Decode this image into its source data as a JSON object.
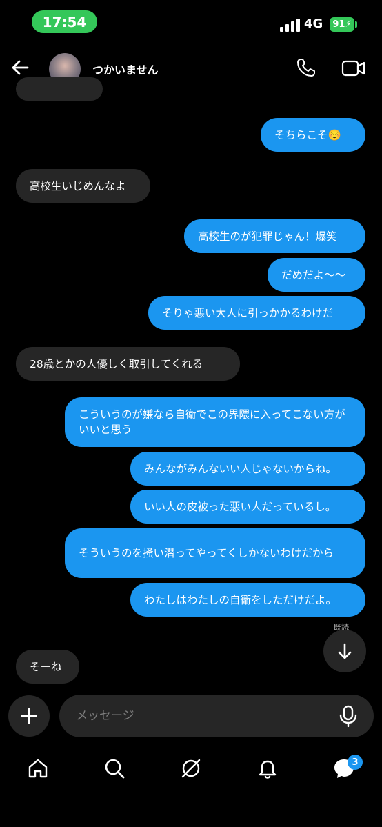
{
  "status_bar": {
    "time": "17:54",
    "network": "4G",
    "battery": "91"
  },
  "header": {
    "contact_name": "つかいません"
  },
  "messages": [
    {
      "side": "out",
      "text": "そちらこそ☺️"
    },
    {
      "side": "in",
      "text": "高校生いじめんなよ"
    },
    {
      "side": "out",
      "text": "高校生のが犯罪じゃん！爆笑"
    },
    {
      "side": "out",
      "text": "だめだよ〜〜"
    },
    {
      "side": "out",
      "text": "そりゃ悪い大人に引っかかるわけだ"
    },
    {
      "side": "in",
      "text": "28歳とかの人優しく取引してくれる"
    },
    {
      "side": "out",
      "text": "こういうのが嫌なら自衛でこの界隈に入ってこない方がいいと思う"
    },
    {
      "side": "out",
      "text": "みんながみんないい人じゃないからね。"
    },
    {
      "side": "out",
      "text": "いい人の皮被った悪い人だっているし。"
    },
    {
      "side": "out",
      "text": "そういうのを掻い潜ってやってくしかないわけだから"
    },
    {
      "side": "out",
      "text": "わたしはわたしの自衛をしただけだよ。"
    },
    {
      "side": "in",
      "text": "そーね"
    }
  ],
  "read_receipt": "既読",
  "composer": {
    "placeholder": "メッセージ"
  },
  "tabbar": {
    "messages_badge": "3"
  },
  "colors": {
    "outgoing_bubble": "#1b96f0",
    "incoming_bubble": "#262626",
    "time_pill": "#34c759"
  },
  "icons": [
    "back-arrow-icon",
    "phone-icon",
    "video-call-icon",
    "arrow-down-icon",
    "plus-icon",
    "microphone-icon",
    "home-icon",
    "search-icon",
    "compass-icon",
    "bell-icon",
    "chat-bubble-icon"
  ]
}
